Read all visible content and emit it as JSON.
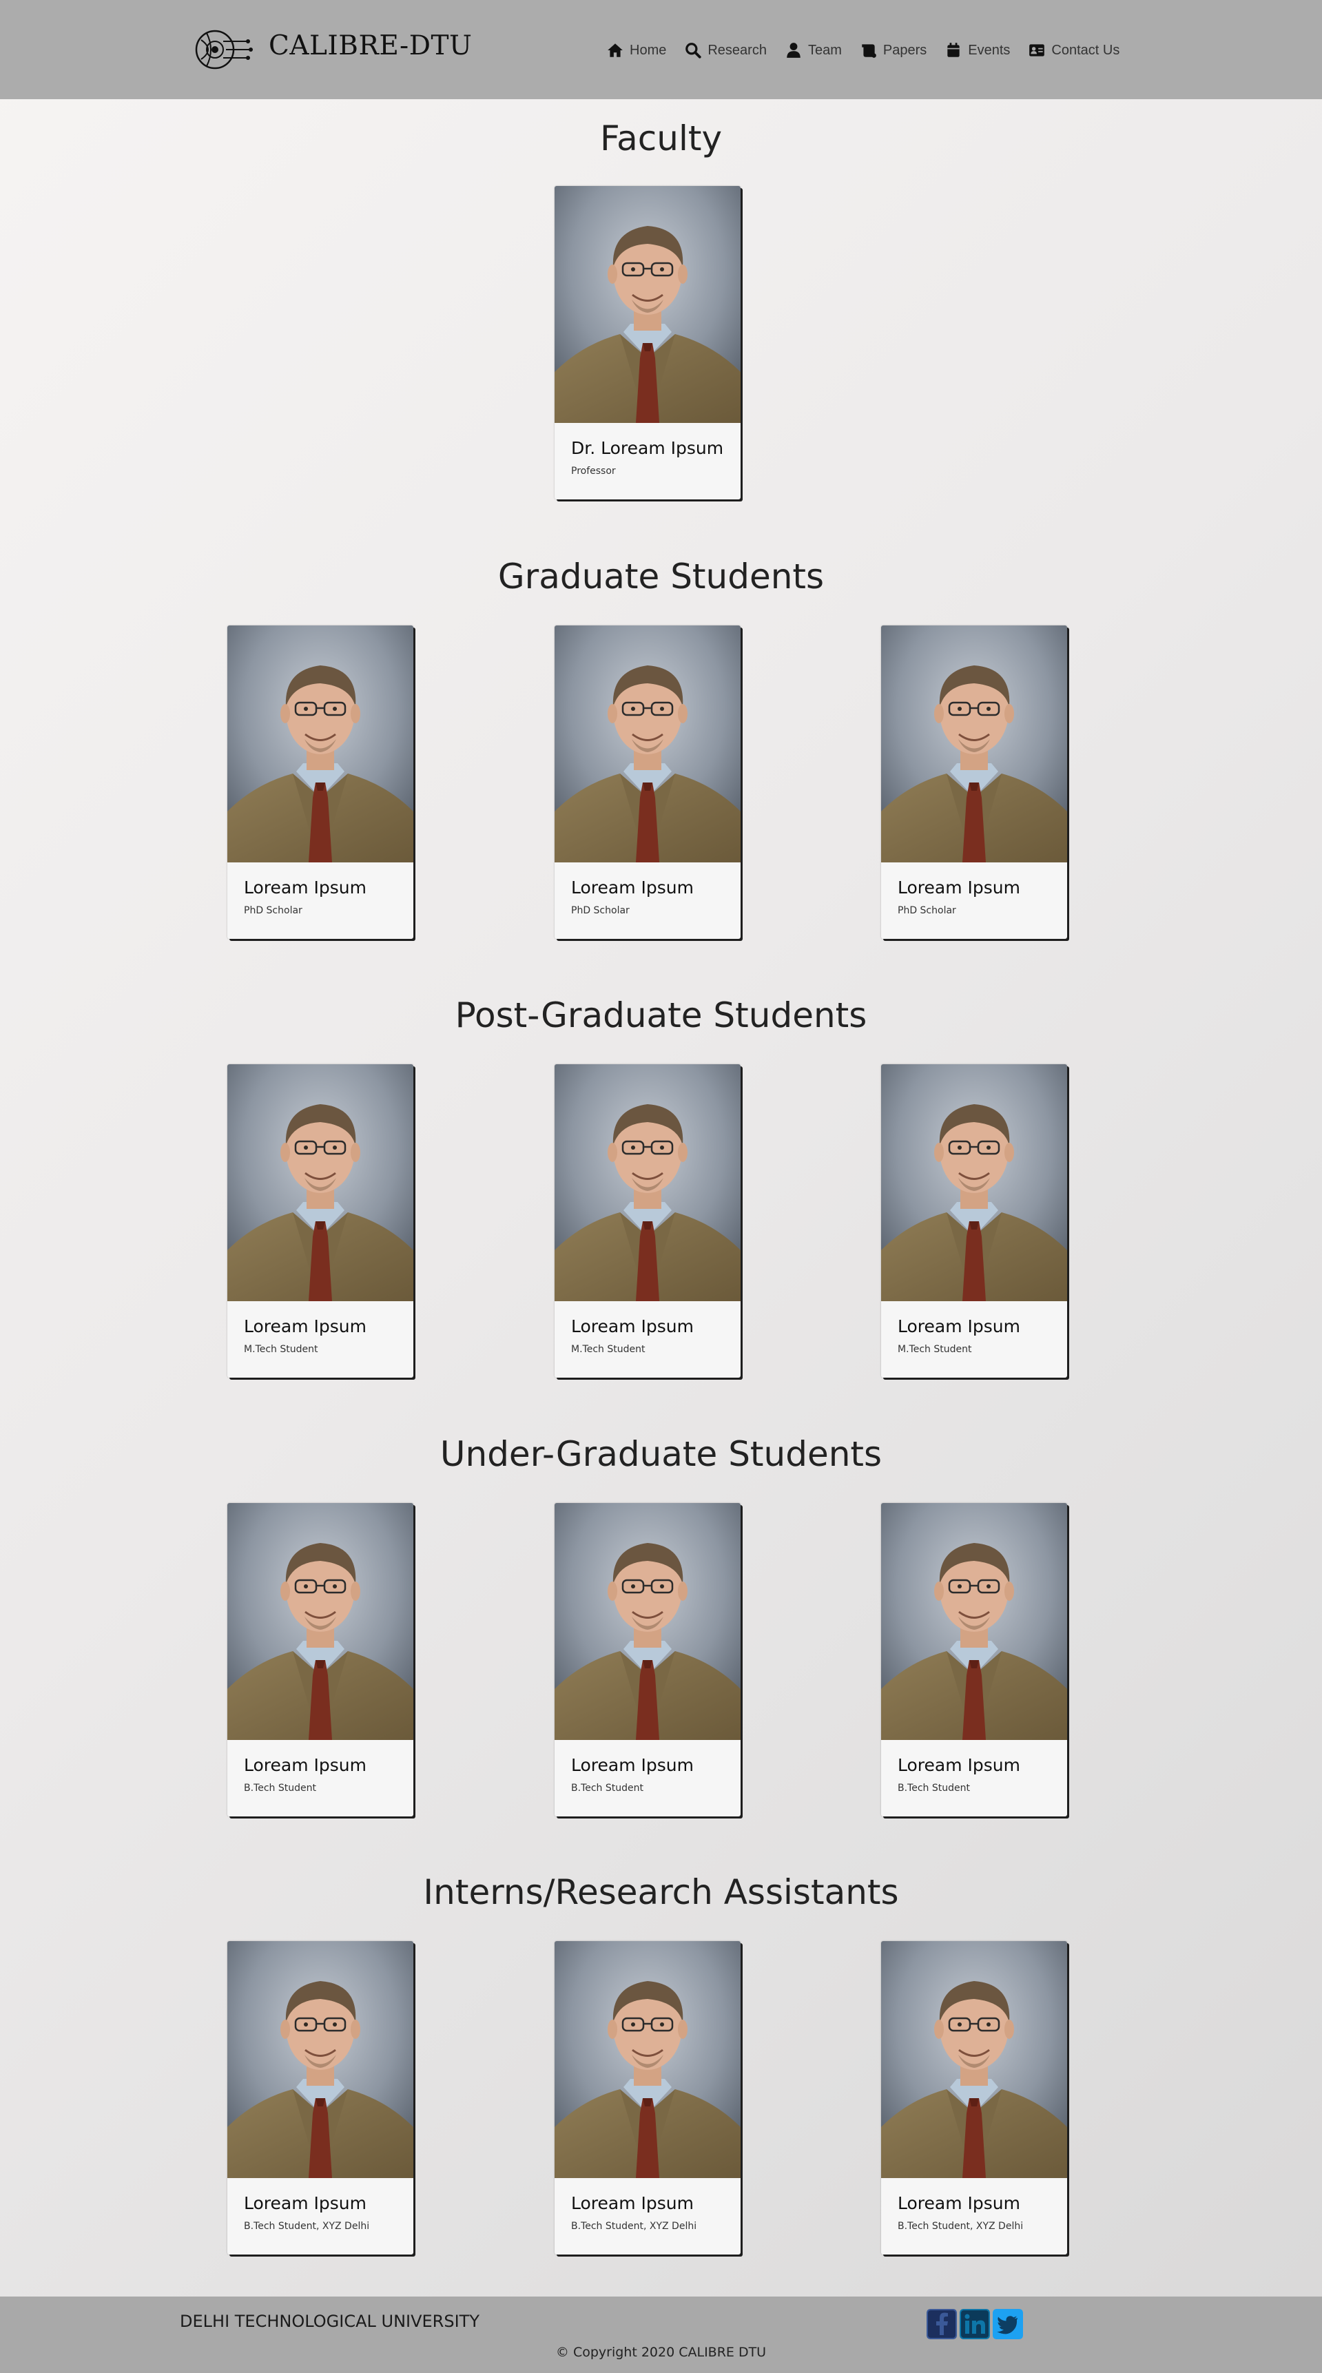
{
  "header": {
    "brand": "CALIBRE-DTU",
    "nav": [
      {
        "label": "Home",
        "icon": "home-icon"
      },
      {
        "label": "Research",
        "icon": "search-icon"
      },
      {
        "label": "Team",
        "icon": "user-icon"
      },
      {
        "label": "Papers",
        "icon": "scroll-icon"
      },
      {
        "label": "Events",
        "icon": "calendar-icon"
      },
      {
        "label": "Contact Us",
        "icon": "address-card-icon"
      }
    ]
  },
  "sections": [
    {
      "title": "Faculty",
      "members": [
        {
          "name": "Dr. Loream Ipsum",
          "role": "Professor"
        }
      ]
    },
    {
      "title": "Graduate Students",
      "members": [
        {
          "name": "Loream Ipsum",
          "role": "PhD Scholar"
        },
        {
          "name": "Loream Ipsum",
          "role": "PhD Scholar"
        },
        {
          "name": "Loream Ipsum",
          "role": "PhD Scholar"
        }
      ]
    },
    {
      "title": "Post-Graduate Students",
      "members": [
        {
          "name": "Loream Ipsum",
          "role": "M.Tech Student"
        },
        {
          "name": "Loream Ipsum",
          "role": "M.Tech Student"
        },
        {
          "name": "Loream Ipsum",
          "role": "M.Tech Student"
        }
      ]
    },
    {
      "title": "Under-Graduate Students",
      "members": [
        {
          "name": "Loream Ipsum",
          "role": "B.Tech Student"
        },
        {
          "name": "Loream Ipsum",
          "role": "B.Tech Student"
        },
        {
          "name": "Loream Ipsum",
          "role": "B.Tech Student"
        }
      ]
    },
    {
      "title": "Interns/Research Assistants",
      "members": [
        {
          "name": "Loream Ipsum",
          "role": "B.Tech Student, XYZ Delhi"
        },
        {
          "name": "Loream Ipsum",
          "role": "B.Tech Student, XYZ Delhi"
        },
        {
          "name": "Loream Ipsum",
          "role": "B.Tech Student, XYZ Delhi"
        }
      ]
    }
  ],
  "footer": {
    "university": "DELHI TECHNOLOGICAL UNIVERSITY",
    "copyright": "© Copyright 2020 CALIBRE DTU",
    "social": [
      {
        "icon": "facebook-icon",
        "color": "#3b5998"
      },
      {
        "icon": "linkedin-icon",
        "color": "#0e76a8"
      },
      {
        "icon": "twitter-icon",
        "color": "#1da1f2"
      }
    ]
  },
  "colors": {
    "header_bg": "#acacac",
    "footer_bg": "#a9a9a9",
    "card_bg": "#f6f6f6"
  }
}
